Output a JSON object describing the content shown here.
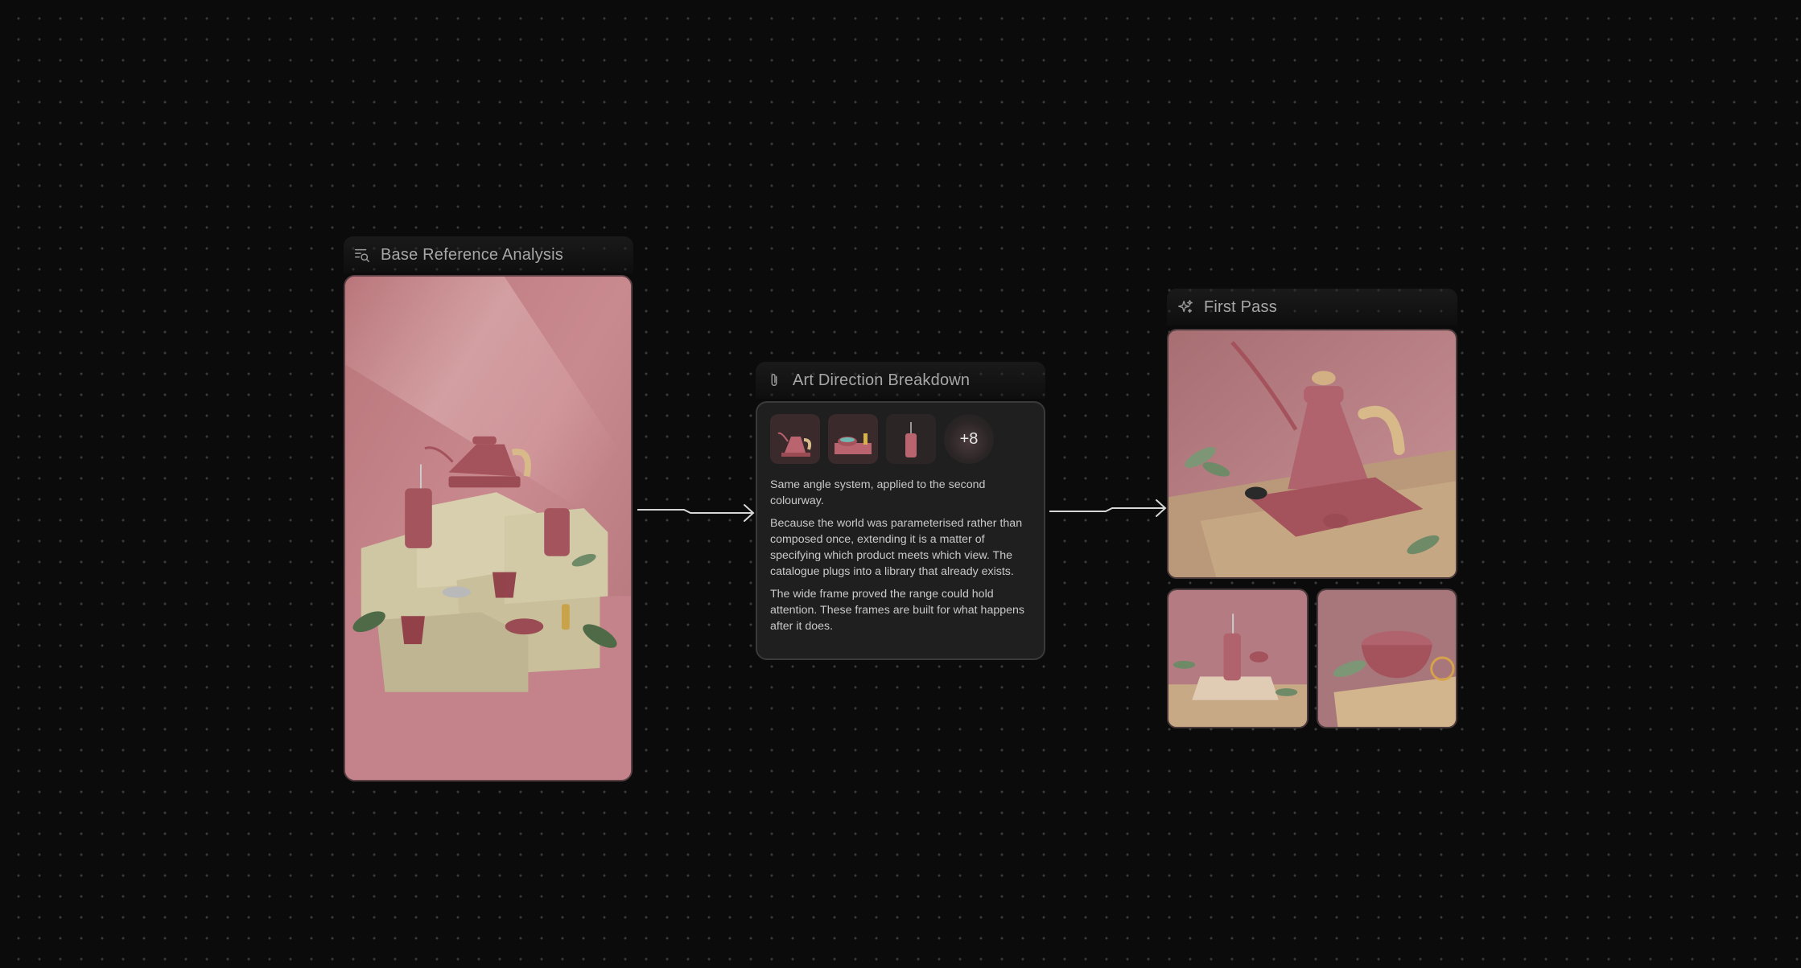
{
  "nodes": {
    "base_reference": {
      "title": "Base Reference Analysis",
      "icon": "search-list-icon"
    },
    "art_direction": {
      "title": "Art Direction Breakdown",
      "icon": "paperclip-icon",
      "more_count": "+8",
      "paragraphs": [
        "Same angle system, applied to the second colourway.",
        "Because the world was parameterised rather than composed once, extending it is a matter of specifying which product meets which view. The catalogue plugs into a library that already exists.",
        "The wide frame proved the range could hold attention. These frames are built for what happens after it does."
      ]
    },
    "first_pass": {
      "title": "First Pass",
      "icon": "sparkles-icon"
    }
  },
  "colors": {
    "background": "#0b0b0b",
    "dot": "#3a3a3a",
    "card": "#1f1f1f",
    "accent_pink": "#c8858a",
    "connector": "#cfcfcf"
  }
}
